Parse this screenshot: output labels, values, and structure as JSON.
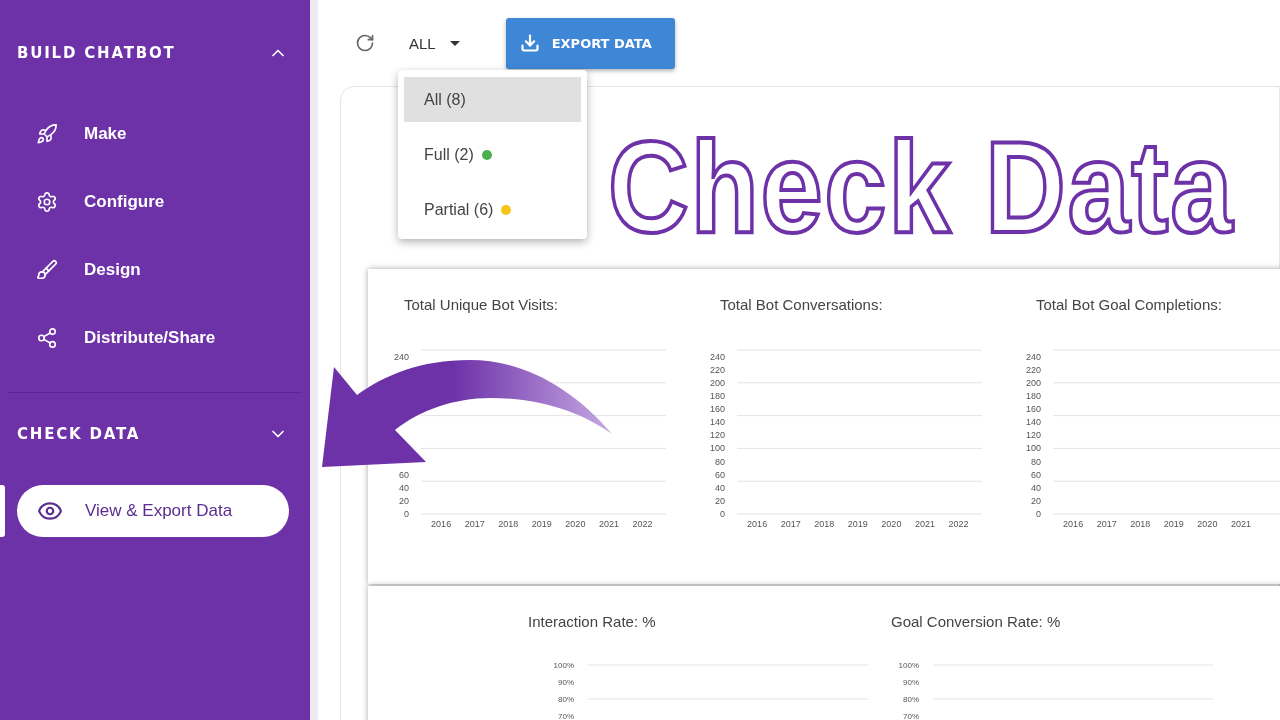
{
  "sidebar": {
    "sections": [
      {
        "title": "BUILD CHATBOT",
        "expanded": true,
        "items": [
          {
            "label": "Make",
            "selected": false
          },
          {
            "label": "Configure",
            "selected": false
          },
          {
            "label": "Design",
            "selected": false
          },
          {
            "label": "Distribute/Share",
            "selected": false
          }
        ]
      },
      {
        "title": "CHECK DATA",
        "expanded": false,
        "items": [
          {
            "label": "View & Export Data",
            "selected": true
          }
        ]
      }
    ]
  },
  "toolbar": {
    "filter": "ALL",
    "export_button": "EXPORT DATA"
  },
  "filter_menu": [
    {
      "label": "All (8)",
      "selected": true
    },
    {
      "label": "Full (2)",
      "selected": false,
      "color": "#4caf50"
    },
    {
      "label": "Partial (6)",
      "selected": false,
      "color": "#f5c518"
    }
  ],
  "overlay_title": "Check Data",
  "top_charts": [
    {
      "chart_data": {
        "type": "bar",
        "title": "Total Unique Bot Visits:",
        "categories": [
          "2016",
          "2017",
          "2018",
          "2019",
          "2020",
          "2021",
          "2022"
        ],
        "values": [
          0,
          0,
          0,
          0,
          0,
          0,
          0
        ],
        "ylim": [
          0,
          250
        ],
        "yticks": [
          0,
          20,
          40,
          60,
          240
        ]
      }
    },
    {
      "chart_data": {
        "type": "bar",
        "title": "Total Bot Conversations:",
        "categories": [
          "2016",
          "2017",
          "2018",
          "2019",
          "2020",
          "2021",
          "2022"
        ],
        "values": [
          0,
          0,
          0,
          0,
          0,
          0,
          0
        ],
        "ylim": [
          0,
          250
        ],
        "yticks": [
          0,
          20,
          40,
          60,
          80,
          100,
          120,
          140,
          160,
          180,
          200,
          220,
          240
        ]
      }
    },
    {
      "chart_data": {
        "type": "bar",
        "title": "Total Bot Goal Completions:",
        "categories": [
          "2016",
          "2017",
          "2018",
          "2019",
          "2020",
          "2021"
        ],
        "values": [
          0,
          0,
          0,
          0,
          0,
          0
        ],
        "ylim": [
          0,
          250
        ],
        "yticks": [
          0,
          20,
          40,
          60,
          80,
          100,
          120,
          140,
          160,
          180,
          200,
          220,
          240
        ]
      }
    }
  ],
  "bottom_charts": [
    {
      "title": "Interaction Rate: %",
      "axis_labels": [
        "100%",
        "90%",
        "80%",
        "70%"
      ]
    },
    {
      "title": "Goal Conversion Rate: %",
      "axis_labels": [
        "100%",
        "90%",
        "80%",
        "70%"
      ]
    }
  ]
}
